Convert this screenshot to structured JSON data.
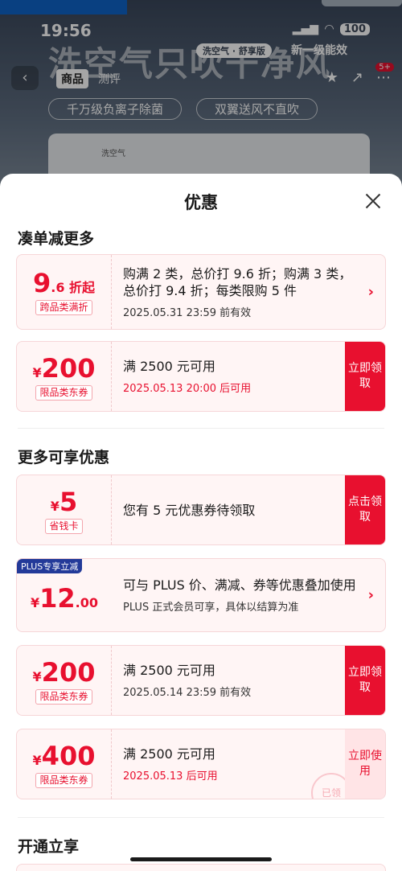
{
  "background": {
    "status_time": "19:56",
    "battery": "100",
    "hero_text": "洗空气只吹干净风",
    "hero_pill": "洗空气 · 舒享版",
    "hero_tagline": "新一级能效",
    "nav_tabs": [
      "商品",
      "测评"
    ],
    "features": [
      "千万级负离子除菌",
      "双翼送风不直吹"
    ],
    "cart_badge": "5+",
    "unit_label": "洗空气"
  },
  "sheet": {
    "title": "优惠",
    "sections": {
      "combo": "凑单减更多",
      "more": "更多可享优惠",
      "open": "开通立享"
    }
  },
  "cards": {
    "discount": {
      "amount_big": "9",
      "amount_small": ".6 折起",
      "tag": "跨品类满折",
      "main": "购满 2 类，总价打 9.6 折；购满 3 类，总价打 9.4 折；每类限购 5 件",
      "sub": "2025.05.31 23:59 前有效"
    },
    "coupon_200_a": {
      "currency": "¥",
      "amount_big": "200",
      "tag": "限品类东券",
      "main": "满 2500 元可用",
      "sub": "2025.05.13 20:00 后可用",
      "button": "立即领取"
    },
    "savings_card": {
      "currency": "¥",
      "amount_big": "5",
      "tag": "省钱卡",
      "main": "您有 5 元优惠券待领取",
      "button": "点击领取"
    },
    "plus": {
      "ribbon": "PLUS专享立减",
      "currency": "¥",
      "amount_big": "12",
      "amount_small": ".00",
      "main": "可与 PLUS 价、满减、券等优惠叠加使用",
      "sub": "PLUS 正式会员可享，具体以结算为准"
    },
    "coupon_200_b": {
      "currency": "¥",
      "amount_big": "200",
      "tag": "限品类东券",
      "main": "满 2500 元可用",
      "sub": "2025.05.14 23:59 前有效",
      "button": "立即领取"
    },
    "coupon_400": {
      "currency": "¥",
      "amount_big": "400",
      "tag": "限品类东券",
      "main": "满 2500 元可用",
      "sub": "2025.05.13 后可用",
      "button": "立即使用",
      "stamp": "已领"
    }
  },
  "colors": {
    "accent": "#e8102f",
    "card_bg": "#fff5f5",
    "plus_blue": "#233a99"
  }
}
